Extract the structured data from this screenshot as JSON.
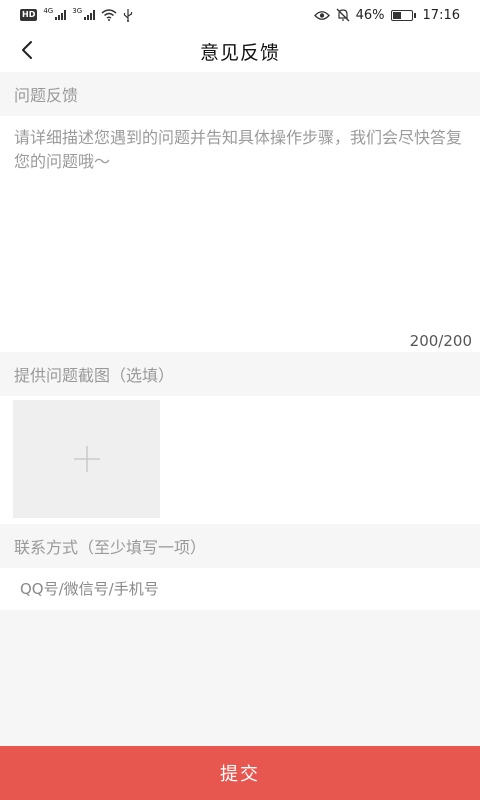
{
  "status_bar": {
    "hd_badge": "HD",
    "network_1": "4G",
    "network_2": "3G",
    "battery_percent": "46%",
    "battery_level": 0.46,
    "time": "17:16",
    "icons": [
      "signal-icon",
      "wifi-icon",
      "usb-icon",
      "eye-icon",
      "mute-icon",
      "battery-icon"
    ]
  },
  "nav": {
    "back_icon": "chevron-left-icon",
    "title": "意见反馈"
  },
  "feedback": {
    "section_label": "问题反馈",
    "placeholder": "请详细描述您遇到的问题并告知具体操作步骤，我们会尽快答复您的问题哦～",
    "value": "",
    "char_count": "200/200"
  },
  "screenshot": {
    "section_label": "提供问题截图（选填）",
    "add_icon": "plus-icon"
  },
  "contact": {
    "section_label": "联系方式（至少填写一项）",
    "placeholder": "QQ号/微信号/手机号",
    "value": ""
  },
  "submit": {
    "label": "提交"
  },
  "colors": {
    "accent": "#e8574f",
    "background": "#f6f6f6",
    "label": "#9a9a9a"
  }
}
